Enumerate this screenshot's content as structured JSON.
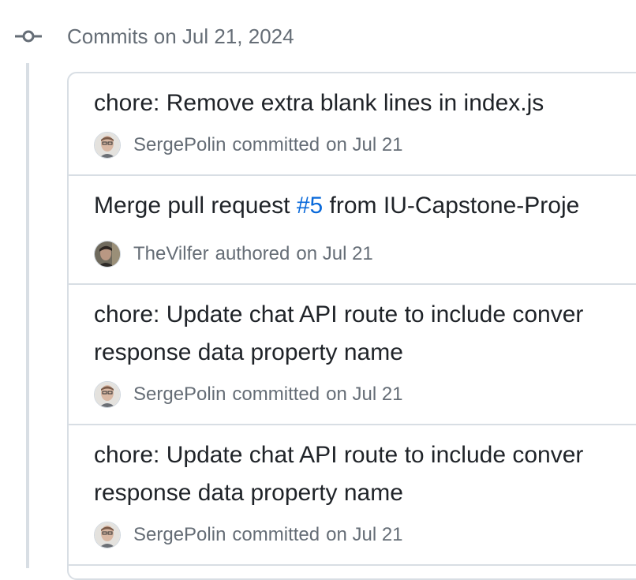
{
  "group": {
    "title": "Commits on Jul 21, 2024"
  },
  "commits": [
    {
      "title": "chore: Remove extra blank lines in index.js",
      "author": "SergePolin",
      "verb": "committed",
      "date": "on Jul 21",
      "avatar_icon": "avatar-sergepolin"
    },
    {
      "title_prefix": "Merge pull request ",
      "pr_number": "#5",
      "title_suffix": " from IU-Capstone-Proje",
      "author": "TheVilfer",
      "verb": "authored",
      "date": "on Jul 21",
      "avatar_icon": "avatar-thevilfer"
    },
    {
      "title_line1": "chore: Update chat API route to include conver",
      "title_line2": "response data property name",
      "author": "SergePolin",
      "verb": "committed",
      "date": "on Jul 21",
      "avatar_icon": "avatar-sergepolin"
    },
    {
      "title_line1": "chore: Update chat API route to include conver",
      "title_line2": "response data property name",
      "author": "SergePolin",
      "verb": "committed",
      "date": "on Jul 21",
      "avatar_icon": "avatar-sergepolin"
    }
  ],
  "colors": {
    "link": "#0969da",
    "muted": "#656d76",
    "border": "#d8dee4"
  }
}
